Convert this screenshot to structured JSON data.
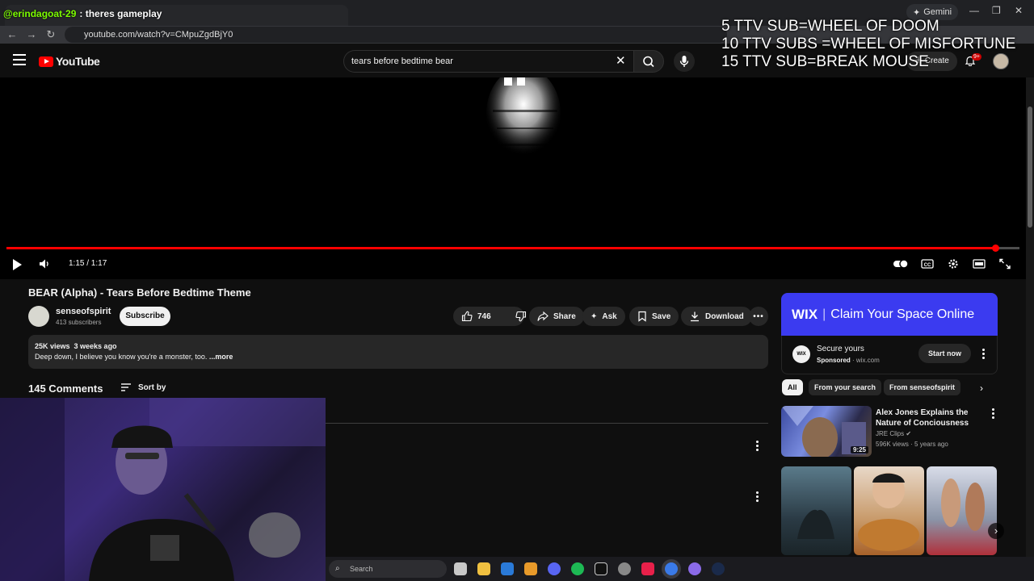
{
  "browser": {
    "tab_chat_user": "@erindagoat-29",
    "tab_chat_message": ": theres gameplay",
    "gemini_label": "Gemini",
    "url": "youtube.com/watch?v=CMpuZgdBjY0"
  },
  "stream_overlay": {
    "line1": "5 TTV SUB=WHEEL OF DOOM",
    "line2": "10 TTV SUBS =WHEEL OF MISFORTUNE",
    "line3": "15 TTV SUB=BREAK MOUSE"
  },
  "header": {
    "logo_text": "YouTube",
    "search_value": "tears before bedtime bear",
    "create_label": "Create",
    "notifications_badge": "9+"
  },
  "player": {
    "time_display": "1:15 / 1:17",
    "progress": 0.976
  },
  "video": {
    "title": "BEAR (Alpha) - Tears Before Bedtime Theme",
    "channel_name": "senseofspirit",
    "subscribers": "413 subscribers",
    "subscribe_label": "Subscribe",
    "like_count": "746",
    "share_label": "Share",
    "ask_label": "Ask",
    "save_label": "Save",
    "download_label": "Download",
    "views_date": "25K views  3 weeks ago",
    "description": "Deep down, I believe you know you're a monster, too. ",
    "more_label": "...more"
  },
  "comments": {
    "count": "145 Comments",
    "sort_label": "Sort by"
  },
  "ad": {
    "banner_brand": "WIX",
    "banner_text": "Claim Your Space Online",
    "logo_text": "WIX",
    "title": "Secure yours",
    "sponsored": "Sponsored",
    "domain": " · wix.com",
    "cta_label": "Start now"
  },
  "chips": [
    "All",
    "From your search",
    "From senseofspirit"
  ],
  "recommendation": {
    "title": "Alex Jones Explains the Nature of Conciousness",
    "channel": "JRE Clips",
    "meta": "596K views · 5 years ago",
    "duration": "9:25"
  },
  "taskbar": {
    "search_placeholder": "Search"
  },
  "colors": {
    "accent_red": "#ff0000",
    "wix_blue": "#3b3bf0",
    "background": "#0f0f0f"
  }
}
